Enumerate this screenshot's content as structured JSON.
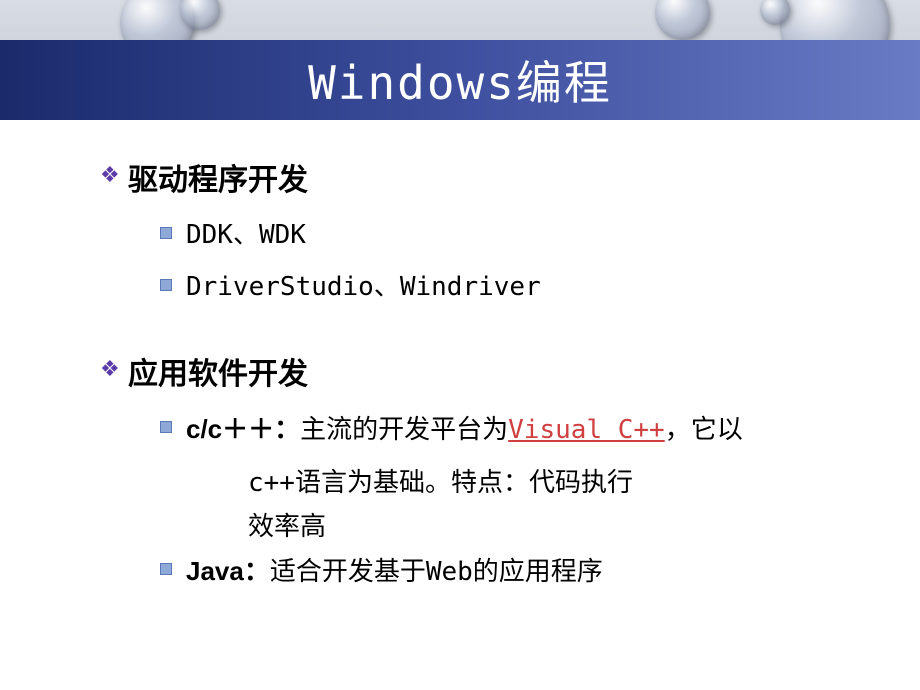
{
  "slide": {
    "title": "Windows编程",
    "sections": [
      {
        "heading": "驱动程序开发",
        "items": [
          {
            "text": "DDK、WDK"
          },
          {
            "text": "DriverStudio、Windriver"
          }
        ]
      },
      {
        "heading": "应用软件开发",
        "items": [
          {
            "label": "c/c＋＋：",
            "prefix": "主流的开发平台为",
            "link": "Visual C++",
            "suffix": "，它以",
            "line2": "c++语言为基础。特点：代码执行",
            "line3": "效率高"
          },
          {
            "label": "Java：",
            "prefix": "适合开发基于Web的应用程序"
          }
        ]
      }
    ]
  }
}
